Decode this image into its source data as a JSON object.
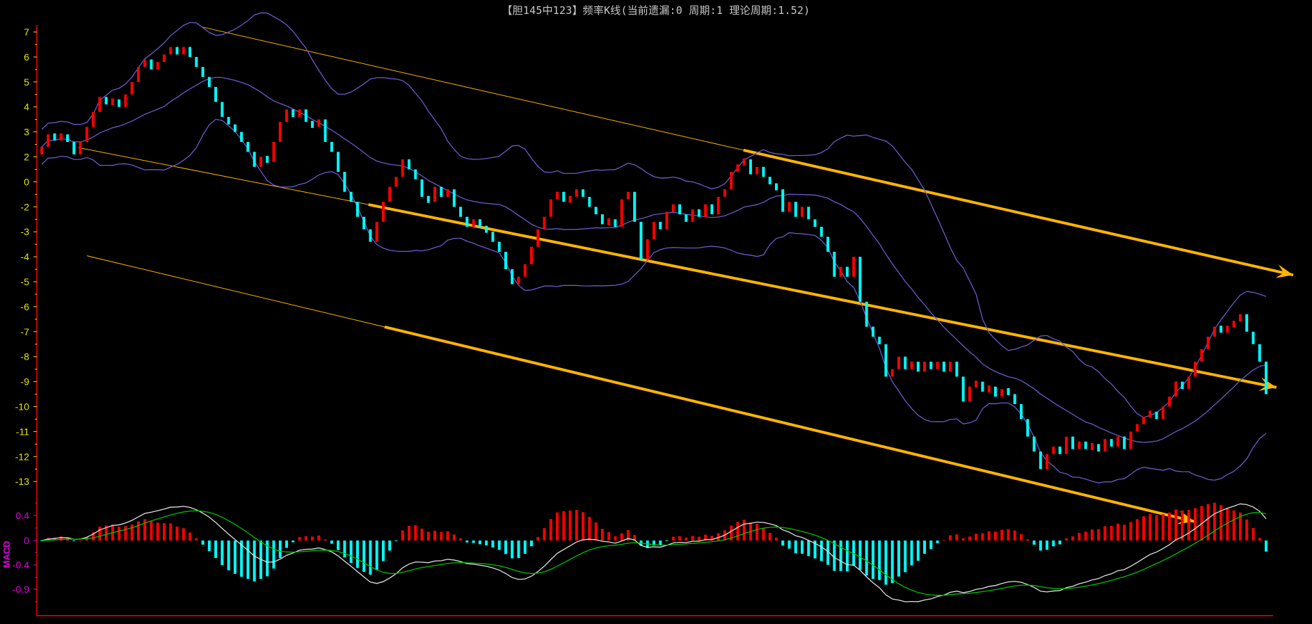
{
  "title": "【胆145中123】频率K线(当前遗漏:0 周期:1 理论周期:1.52)",
  "colors": {
    "up": "#ff0000",
    "down": "#00ffff",
    "band": "#6a5acd",
    "trend": "#ffb400",
    "axis": "#c00000",
    "dif": "#e0e0e0",
    "dea": "#00c000",
    "price_label": "#e6e600",
    "macd_label": "#e000e0"
  },
  "chart_data": [
    {
      "type": "candlestick",
      "name": "frequency-kline",
      "yticks": {
        "labels": [
          "7",
          "6",
          "5",
          "4",
          "3",
          "2",
          "0",
          "-2",
          "-3",
          "-4",
          "-5",
          "-6",
          "-7",
          "-8",
          "-9",
          "-10",
          "-11",
          "-12",
          "-13"
        ],
        "values": [
          7,
          6,
          5,
          4,
          3,
          2,
          1,
          0,
          -1,
          -2,
          -3,
          -4,
          -5,
          -6,
          -7,
          -8,
          -9,
          -10,
          -11
        ]
      },
      "ylim": [
        -11.3,
        7.4
      ],
      "bollinger": {
        "period": 20,
        "k": 2
      },
      "closes": [
        2.4,
        2.9,
        2.7,
        2.9,
        2.6,
        2.1,
        2.6,
        3.2,
        3.8,
        4.4,
        4.1,
        4.3,
        4.0,
        4.5,
        5.0,
        5.6,
        5.9,
        5.5,
        5.8,
        6.1,
        6.4,
        6.1,
        6.4,
        6.0,
        5.6,
        5.2,
        4.8,
        4.2,
        3.6,
        3.3,
        3.0,
        2.6,
        2.2,
        1.6,
        2.0,
        1.8,
        2.6,
        3.4,
        3.9,
        3.6,
        3.9,
        3.4,
        3.2,
        3.5,
        2.6,
        2.2,
        1.4,
        0.6,
        0.2,
        -0.4,
        -0.9,
        -1.4,
        -0.6,
        0.2,
        0.8,
        1.2,
        1.9,
        1.5,
        1.1,
        0.4,
        0.2,
        0.8,
        0.4,
        0.7,
        0.0,
        -0.4,
        -0.8,
        -0.5,
        -0.8,
        -1.0,
        -1.4,
        -1.8,
        -2.5,
        -3.1,
        -2.8,
        -2.3,
        -1.6,
        -0.9,
        -0.4,
        0.3,
        0.6,
        0.2,
        0.4,
        0.7,
        0.4,
        0.0,
        -0.3,
        -0.7,
        -0.5,
        -0.8,
        0.3,
        0.6,
        -0.6,
        -2.1,
        -1.3,
        -0.6,
        -0.9,
        -0.2,
        0.1,
        -0.3,
        -0.6,
        -0.1,
        -0.4,
        0.1,
        -0.3,
        0.4,
        0.7,
        1.4,
        1.7,
        1.9,
        1.3,
        1.6,
        1.2,
        0.9,
        0.7,
        -0.2,
        0.2,
        -0.4,
        0.0,
        -0.5,
        -0.8,
        -1.2,
        -1.8,
        -2.8,
        -2.4,
        -2.8,
        -2.0,
        -3.8,
        -4.8,
        -5.2,
        -5.5,
        -6.8,
        -6.5,
        -6.0,
        -6.5,
        -6.2,
        -6.6,
        -6.2,
        -6.5,
        -6.2,
        -6.6,
        -6.2,
        -6.8,
        -7.8,
        -7.2,
        -7.0,
        -7.4,
        -7.2,
        -7.6,
        -7.3,
        -7.5,
        -7.9,
        -8.5,
        -9.2,
        -9.8,
        -10.5,
        -9.9,
        -9.6,
        -9.9,
        -9.2,
        -9.7,
        -9.4,
        -9.7,
        -9.5,
        -9.8,
        -9.3,
        -9.6,
        -9.2,
        -9.7,
        -9.0,
        -8.7,
        -8.4,
        -8.2,
        -8.5,
        -8.0,
        -7.6,
        -7.0,
        -7.3,
        -6.8,
        -6.2,
        -5.7,
        -5.2,
        -4.8,
        -5.0,
        -4.8,
        -4.6,
        -4.3,
        -5.0,
        -5.5,
        -6.2,
        -7.5
      ],
      "trendlines": [
        {
          "start": [
            24.9,
            7.2
          ],
          "bend": [
            108.9,
            2.27
          ],
          "end": [
            194.2,
            -2.73
          ]
        },
        {
          "start": [
            5.7,
            2.37
          ],
          "bend": [
            50.7,
            0.09
          ],
          "end": [
            191.6,
            -7.23
          ]
        },
        {
          "start": [
            7.0,
            -1.96
          ],
          "bend": [
            53.2,
            -4.81
          ],
          "end": [
            178.9,
            -12.6
          ]
        }
      ]
    },
    {
      "type": "macd",
      "label": "MACD",
      "params": {
        "fast": 12,
        "slow": 26,
        "signal": 9
      },
      "yticks": {
        "labels": [
          "0.4",
          "0",
          "-0.4",
          "-0.9"
        ]
      }
    }
  ]
}
